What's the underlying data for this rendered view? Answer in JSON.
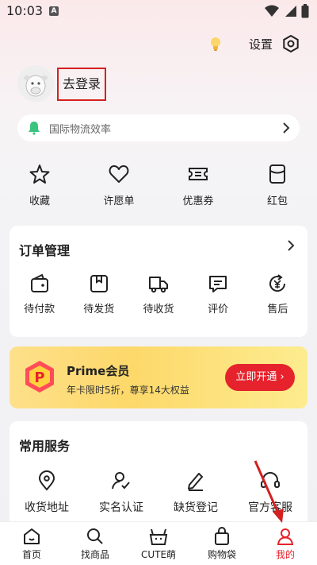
{
  "status": {
    "time": "10:03",
    "a_icon": "A"
  },
  "header": {
    "settings_label": "设置",
    "login_label": "去登录"
  },
  "notice": {
    "text": "国际物流效率"
  },
  "quick": [
    {
      "label": "收藏",
      "icon": "star-icon"
    },
    {
      "label": "许愿单",
      "icon": "heart-icon"
    },
    {
      "label": "优惠券",
      "icon": "coupon-icon"
    },
    {
      "label": "红包",
      "icon": "red-packet-icon"
    }
  ],
  "orders": {
    "title": "订单管理",
    "items": [
      {
        "label": "待付款",
        "icon": "wallet-icon"
      },
      {
        "label": "待发货",
        "icon": "box-icon"
      },
      {
        "label": "待收货",
        "icon": "truck-icon"
      },
      {
        "label": "评价",
        "icon": "comment-icon"
      },
      {
        "label": "售后",
        "icon": "refund-icon"
      }
    ]
  },
  "prime": {
    "title": "Prime会员",
    "subtitle": "年卡限时5折，尊享14大权益",
    "button": "立即开通",
    "logo_letter": "P"
  },
  "services": {
    "title": "常用服务",
    "items": [
      {
        "label": "收货地址",
        "icon": "location-icon"
      },
      {
        "label": "实名认证",
        "icon": "user-check-icon"
      },
      {
        "label": "缺货登记",
        "icon": "pen-icon"
      },
      {
        "label": "官方客服",
        "icon": "headset-icon"
      }
    ]
  },
  "nav": [
    {
      "label": "首页",
      "icon": "home-icon"
    },
    {
      "label": "找商品",
      "icon": "search-icon"
    },
    {
      "label": "CUTE萌",
      "icon": "cute-icon"
    },
    {
      "label": "购物袋",
      "icon": "bag-icon"
    },
    {
      "label": "我的",
      "icon": "user-icon",
      "active": true
    }
  ],
  "colors": {
    "accent": "#e6222c",
    "prime_bg": "#fdd86a",
    "annotation": "#d42020"
  }
}
